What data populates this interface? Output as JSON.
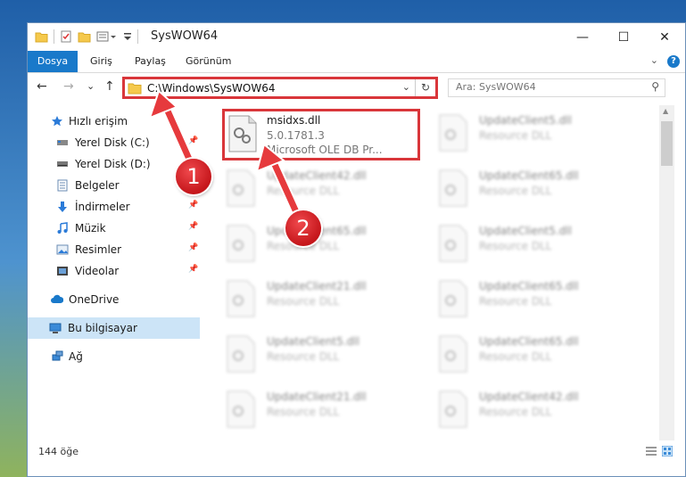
{
  "window": {
    "title": "SysWOW64",
    "minimize_glyph": "—",
    "maximize_glyph": "☐",
    "close_glyph": "✕"
  },
  "ribbon": {
    "tabs": [
      "Dosya",
      "Giriş",
      "Paylaş",
      "Görünüm"
    ],
    "help_glyph": "?",
    "expand_glyph": "⌄"
  },
  "nav": {
    "back_glyph": "←",
    "forward_glyph": "→",
    "recent_glyph": "⌄",
    "up_glyph": "↑",
    "address": "C:\\Windows\\SysWOW64",
    "dropdown_glyph": "⌄",
    "refresh_glyph": "↻"
  },
  "search": {
    "placeholder": "Ara: SysWOW64",
    "icon": "search-icon",
    "glyph": "⚲"
  },
  "sidebar": {
    "items": [
      {
        "label": "Hızlı erişim",
        "icon": "star-icon",
        "pinned": false
      },
      {
        "label": "Yerel Disk (C:)",
        "icon": "drive-icon",
        "pinned": true
      },
      {
        "label": "Yerel Disk (D:)",
        "icon": "drive-icon",
        "pinned": true
      },
      {
        "label": "Belgeler",
        "icon": "documents-icon",
        "pinned": true
      },
      {
        "label": "İndirmeler",
        "icon": "downloads-icon",
        "pinned": true
      },
      {
        "label": "Müzik",
        "icon": "music-icon",
        "pinned": true
      },
      {
        "label": "Resimler",
        "icon": "pictures-icon",
        "pinned": true
      },
      {
        "label": "Videolar",
        "icon": "videos-icon",
        "pinned": true
      },
      {
        "label": "OneDrive",
        "icon": "cloud-icon",
        "pinned": false
      },
      {
        "label": "Bu bilgisayar",
        "icon": "computer-icon",
        "pinned": false
      },
      {
        "label": "Ağ",
        "icon": "network-icon",
        "pinned": false
      }
    ],
    "pin_glyph": "📌"
  },
  "files": [
    {
      "name": "msidxs.dll",
      "line1": "5.0.1781.3",
      "line2": "Microsoft OLE DB Pr...",
      "highlighted": true
    },
    {
      "name": "UpdateClient5.dll",
      "line1": "Resource DLL"
    },
    {
      "name": "UpdateClient42.dll",
      "line1": "Resource DLL"
    },
    {
      "name": "UpdateClient65.dll",
      "line1": "Resource DLL"
    },
    {
      "name": "UpdateClient65.dll",
      "line1": "Resource DLL"
    },
    {
      "name": "UpdateClient5.dll",
      "line1": "Resource DLL"
    },
    {
      "name": "UpdateClient21.dll",
      "line1": "Resource DLL"
    },
    {
      "name": "UpdateClient65.dll",
      "line1": "Resource DLL"
    },
    {
      "name": "UpdateClient5.dll",
      "line1": "Resource DLL"
    },
    {
      "name": "UpdateClient65.dll",
      "line1": "Resource DLL"
    },
    {
      "name": "UpdateClient21.dll",
      "line1": "Resource DLL"
    },
    {
      "name": "UpdateClient42.dll",
      "line1": "Resource DLL"
    }
  ],
  "status": {
    "count": "144 öğe"
  },
  "annotations": {
    "step1": "1",
    "step2": "2"
  },
  "colors": {
    "accent": "#1979ca",
    "highlight": "#d9363a",
    "selected": "#cce4f7"
  }
}
